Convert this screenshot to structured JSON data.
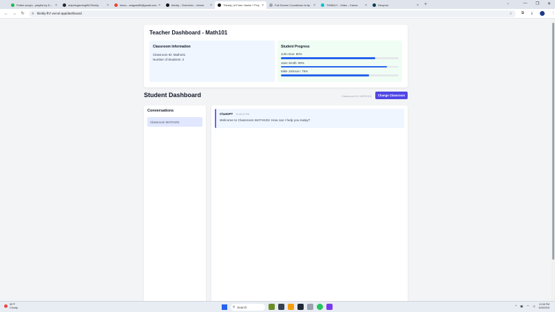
{
  "browser": {
    "tabs": [
      {
        "label": "Polish song's - playlist by Doryn",
        "color": "#1db954",
        "active": false
      },
      {
        "label": "dolphingaming/BLThinkly",
        "color": "#24292e",
        "active": false
      },
      {
        "label": "Inbox - aragatu89@gmail.com",
        "color": "#ea4335",
        "active": false
      },
      {
        "label": "thinkly - Overview – Vercel",
        "color": "#111111",
        "active": false
      },
      {
        "label": "Thinkly | A Futur Hacks 7 Proj",
        "color": "#111111",
        "active": true
      },
      {
        "label": "Full Screen Countdown to tip",
        "color": "#9ca3af",
        "active": false
      },
      {
        "label": "THINKLY - Video - Canva",
        "color": "#00c4cc",
        "active": false
      },
      {
        "label": "Devpost",
        "color": "#003e54",
        "active": false
      }
    ],
    "url": "thinkly-fh7.vercel.app/dashboard"
  },
  "teacher": {
    "title": "Teacher Dashboard - Math101",
    "info_title": "Classroom Information",
    "classroom_id": "Classroom ID: Math101",
    "num_students": "Number of Students: 3",
    "progress_title": "Student Progress",
    "students": [
      {
        "label": "John Doe: 80%",
        "progress": 0.8
      },
      {
        "label": "Jane Smith: 90%",
        "progress": 0.9
      },
      {
        "label": "Mike Johnson: 75%",
        "progress": 0.75
      }
    ],
    "progress_color": "#2563eb"
  },
  "student": {
    "title": "Student Dashboard",
    "classroom_id": "Classroom ID: MATH101",
    "change_button": "Change Classroom",
    "conversations_title": "Conversations",
    "conversations": [
      "Classroom MATH101"
    ],
    "message": {
      "author": "ChatGPT",
      "time": "12:08:03 PM",
      "text": "Welcome to Classroom MATH101! How can I help you today?"
    }
  },
  "taskbar": {
    "weather_temp": "59°F",
    "weather_desc": "Cloudy",
    "search_placeholder": "Search",
    "time": "12:08 PM",
    "date": "4/26/2025"
  }
}
